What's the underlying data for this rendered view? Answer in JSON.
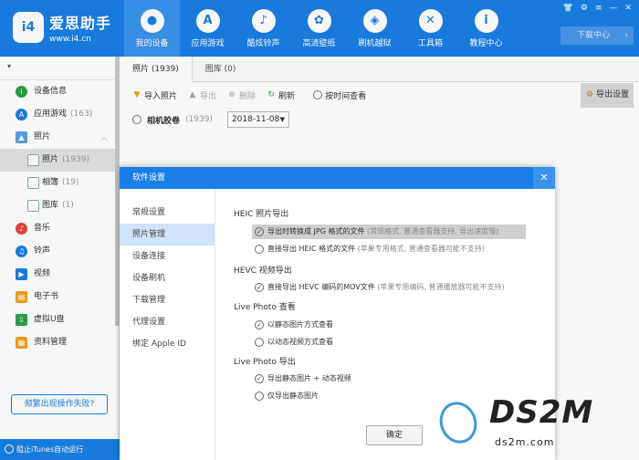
{
  "brand": {
    "title": "爱思助手",
    "url": "www.i4.cn",
    "logo": "i4"
  },
  "nav": [
    {
      "label": "我的设备",
      "icon": "apple-icon",
      "glyph": ""
    },
    {
      "label": "应用游戏",
      "icon": "appstore-icon",
      "glyph": "A"
    },
    {
      "label": "酷炫铃声",
      "icon": "bell-icon",
      "glyph": "♪"
    },
    {
      "label": "高清壁纸",
      "icon": "flower-icon",
      "glyph": "✿"
    },
    {
      "label": "刷机越狱",
      "icon": "box-icon",
      "glyph": "◈"
    },
    {
      "label": "工具箱",
      "icon": "tools-icon",
      "glyph": "✕"
    },
    {
      "label": "教程中心",
      "icon": "info-icon",
      "glyph": "i"
    }
  ],
  "download_center": "下载中心",
  "sidebar": {
    "items": [
      {
        "label": "设备信息",
        "count": "",
        "icon": "info-icon",
        "color": "#2ba245"
      },
      {
        "label": "应用游戏",
        "count": "(163)",
        "icon": "appstore-icon",
        "color": "#1a7ee6"
      },
      {
        "label": "照片",
        "count": "",
        "icon": "photo-icon",
        "color": "#5aa0e6"
      },
      {
        "label": "照片",
        "count": "(1939)",
        "icon": "photo-sub-icon",
        "color": "#8aa"
      },
      {
        "label": "相簿",
        "count": "(19)",
        "icon": "album-icon",
        "color": "#8aa"
      },
      {
        "label": "图库",
        "count": "(1)",
        "icon": "gallery-icon",
        "color": "#8aa"
      },
      {
        "label": "音乐",
        "count": "",
        "icon": "music-icon",
        "color": "#e8453c"
      },
      {
        "label": "铃声",
        "count": "",
        "icon": "bell-icon",
        "color": "#1a7ee6"
      },
      {
        "label": "视频",
        "count": "",
        "icon": "video-icon",
        "color": "#1a7ee6"
      },
      {
        "label": "电子书",
        "count": "",
        "icon": "book-icon",
        "color": "#f0a020"
      },
      {
        "label": "虚拟U盘",
        "count": "",
        "icon": "usb-icon",
        "color": "#2ba245"
      },
      {
        "label": "资料管理",
        "count": "",
        "icon": "folder-icon",
        "color": "#f0a020"
      }
    ],
    "fail_button": "频繁出现操作失败?",
    "footer": "阻止iTunes自动运行"
  },
  "tabs": [
    {
      "label": "照片 (1939)"
    },
    {
      "label": "图库 (0)"
    }
  ],
  "toolbar": {
    "import": "导入照片",
    "export": "导出",
    "delete": "删除",
    "refresh": "刷新",
    "by_time": "按时间查看",
    "export_settings": "导出设置"
  },
  "filter": {
    "camera_roll": "相机胶卷",
    "count": "(1939)",
    "date": "2018-11-08"
  },
  "dialog": {
    "title": "软件设置",
    "menu": [
      "常规设置",
      "照片管理",
      "设备连接",
      "设备刷机",
      "下载管理",
      "代理设置",
      "绑定 Apple ID"
    ],
    "sections": {
      "heic": "HEIC 照片导出",
      "heic_opt1": "导出时转换成 JPG 格式的文件",
      "heic_opt1_hint": "(常规格式, 普通查看器支持, 导出速度慢)",
      "heic_opt2": "直接导出 HEIC 格式的文件",
      "heic_opt2_hint": "(苹果专用格式, 普通查看器可能不支持)",
      "hevc": "HEVC 视频导出",
      "hevc_opt1": "直接导出 HEVC 编码的MOV文件",
      "hevc_opt1_hint": "(苹果专用编码, 普通播放器可能不支持)",
      "live_view": "Live Photo 查看",
      "live_view_opt1": "以静态图片方式查看",
      "live_view_opt2": "以动态视频方式查看",
      "live_export": "Live Photo 导出",
      "live_export_opt1": "导出静态图片 + 动态视频",
      "live_export_opt2": "仅导出静态图片"
    },
    "ok": "确定"
  },
  "watermark": {
    "big": "DS2M",
    "small": "ds2m.com"
  }
}
